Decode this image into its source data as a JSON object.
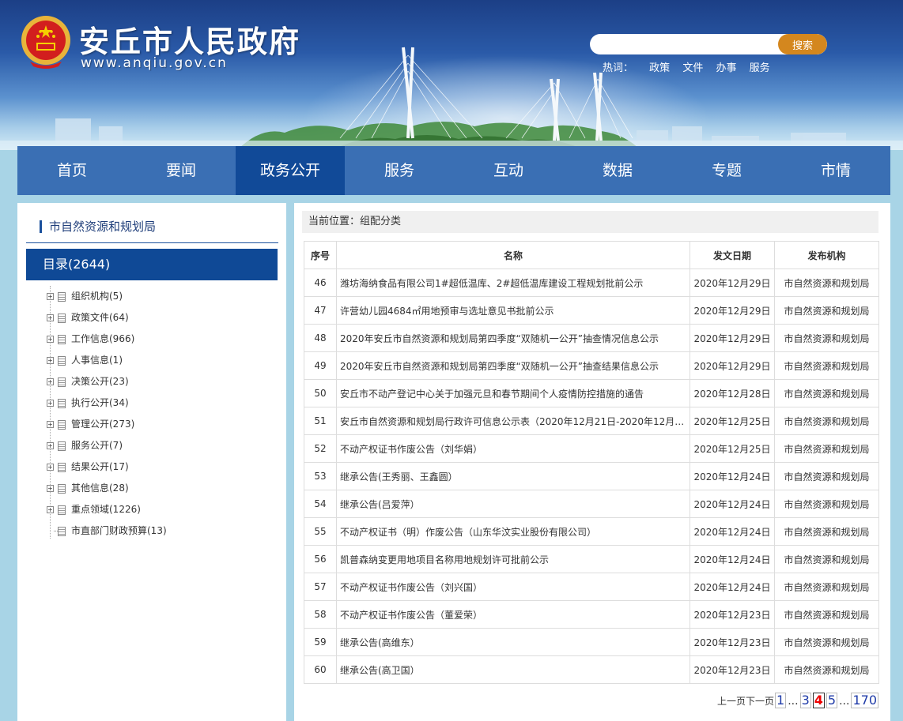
{
  "header": {
    "site_title": "安丘市人民政府",
    "site_url": "www.anqiu.gov.cn",
    "search_placeholder": "",
    "search_button": "搜索",
    "hotwords_label": "热词：",
    "hotwords": [
      "政策",
      "文件",
      "办事",
      "服务"
    ]
  },
  "nav": {
    "items": [
      "首页",
      "要闻",
      "政务公开",
      "服务",
      "互动",
      "数据",
      "专题",
      "市情"
    ],
    "active_index": 2
  },
  "sidebar": {
    "title": "市自然资源和规划局",
    "catalog": "目录(2644)",
    "tree": [
      {
        "label": "组织机构(5)",
        "expandable": true
      },
      {
        "label": "政策文件(64)",
        "expandable": true
      },
      {
        "label": "工作信息(966)",
        "expandable": true
      },
      {
        "label": "人事信息(1)",
        "expandable": true
      },
      {
        "label": "决策公开(23)",
        "expandable": true
      },
      {
        "label": "执行公开(34)",
        "expandable": true
      },
      {
        "label": "管理公开(273)",
        "expandable": true
      },
      {
        "label": "服务公开(7)",
        "expandable": true
      },
      {
        "label": "结果公开(17)",
        "expandable": true
      },
      {
        "label": "其他信息(28)",
        "expandable": true
      },
      {
        "label": "重点领域(1226)",
        "expandable": true
      },
      {
        "label": "市直部门财政预算(13)",
        "expandable": false
      }
    ]
  },
  "content": {
    "breadcrumb": "当前位置：组配分类",
    "table": {
      "headers": [
        "序号",
        "名称",
        "发文日期",
        "发布机构"
      ],
      "rows": [
        {
          "no": "46",
          "title": "潍坊海纳食品有限公司1#超低温库、2#超低温库建设工程规划批前公示",
          "date": "2020年12月29日",
          "org": "市自然资源和规划局"
        },
        {
          "no": "47",
          "title": "许营幼儿园4684㎡用地预审与选址意见书批前公示",
          "date": "2020年12月29日",
          "org": "市自然资源和规划局"
        },
        {
          "no": "48",
          "title": "2020年安丘市自然资源和规划局第四季度“双随机一公开”抽查情况信息公示",
          "date": "2020年12月29日",
          "org": "市自然资源和规划局"
        },
        {
          "no": "49",
          "title": "2020年安丘市自然资源和规划局第四季度“双随机一公开”抽查结果信息公示",
          "date": "2020年12月29日",
          "org": "市自然资源和规划局"
        },
        {
          "no": "50",
          "title": "安丘市不动产登记中心关于加强元旦和春节期间个人疫情防控措施的通告",
          "date": "2020年12月28日",
          "org": "市自然资源和规划局"
        },
        {
          "no": "51",
          "title": "安丘市自然资源和规划局行政许可信息公示表（2020年12月21日-2020年12月2...",
          "date": "2020年12月25日",
          "org": "市自然资源和规划局"
        },
        {
          "no": "52",
          "title": "不动产权证书作废公告（刘华娟）",
          "date": "2020年12月25日",
          "org": "市自然资源和规划局"
        },
        {
          "no": "53",
          "title": "继承公告(王秀丽、王鑫圆）",
          "date": "2020年12月24日",
          "org": "市自然资源和规划局"
        },
        {
          "no": "54",
          "title": "继承公告(吕爱萍）",
          "date": "2020年12月24日",
          "org": "市自然资源和规划局"
        },
        {
          "no": "55",
          "title": "不动产权证书（明）作废公告（山东华汶实业股份有限公司）",
          "date": "2020年12月24日",
          "org": "市自然资源和规划局"
        },
        {
          "no": "56",
          "title": "凯普森纳变更用地项目名称用地规划许可批前公示",
          "date": "2020年12月24日",
          "org": "市自然资源和规划局"
        },
        {
          "no": "57",
          "title": "不动产权证书作废公告（刘兴国）",
          "date": "2020年12月24日",
          "org": "市自然资源和规划局"
        },
        {
          "no": "58",
          "title": "不动产权证书作废公告（董爱荣）",
          "date": "2020年12月23日",
          "org": "市自然资源和规划局"
        },
        {
          "no": "59",
          "title": "继承公告(高维东）",
          "date": "2020年12月23日",
          "org": "市自然资源和规划局"
        },
        {
          "no": "60",
          "title": "继承公告(高卫国）",
          "date": "2020年12月23日",
          "org": "市自然资源和规划局"
        }
      ]
    },
    "pagination": {
      "prev": "上一页",
      "next": "下一页",
      "pages": [
        "1",
        "...",
        "3",
        "4",
        "5",
        "...",
        "170"
      ],
      "current": "4"
    }
  },
  "colors": {
    "nav_bg": "#3a6fb4",
    "nav_active": "#114a98",
    "search_button": "#d4871e",
    "accent_blue": "#0f4996"
  }
}
